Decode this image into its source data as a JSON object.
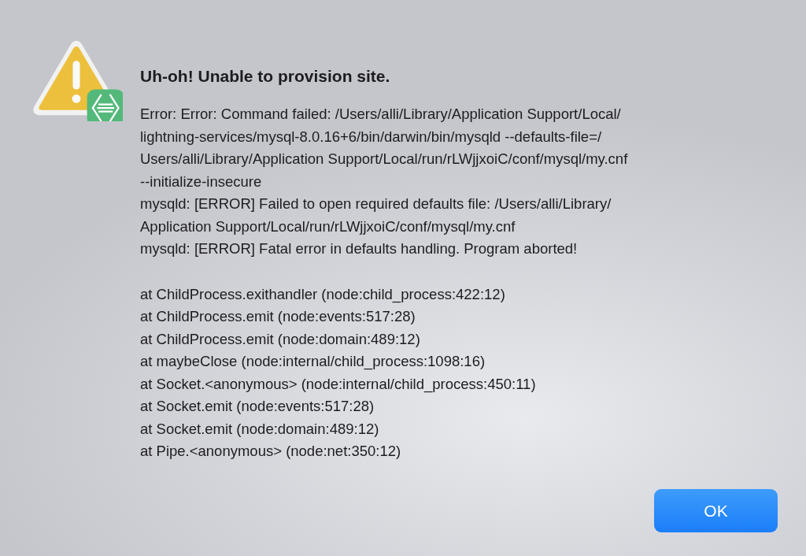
{
  "dialog": {
    "title": "Uh-oh! Unable to provision site.",
    "message_lines": [
      "Error: Error: Command failed: /Users/alli/Library/Application Support/Local/",
      "lightning-services/mysql-8.0.16+6/bin/darwin/bin/mysqld --defaults-file=/",
      "Users/alli/Library/Application Support/Local/run/rLWjjxoiC/conf/mysql/my.cnf",
      "--initialize-insecure",
      "mysqld: [ERROR] Failed to open required defaults file: /Users/alli/Library/",
      "Application Support/Local/run/rLWjjxoiC/conf/mysql/my.cnf",
      "mysqld: [ERROR] Fatal error in defaults handling. Program aborted!"
    ],
    "stack_lines": [
      "at ChildProcess.exithandler (node:child_process:422:12)",
      "at ChildProcess.emit (node:events:517:28)",
      "at ChildProcess.emit (node:domain:489:12)",
      "at maybeClose (node:internal/child_process:1098:16)",
      "at Socket.<anonymous> (node:internal/child_process:450:11)",
      "at Socket.emit (node:events:517:28)",
      "at Socket.emit (node:domain:489:12)",
      "at Pipe.<anonymous> (node:net:350:12)"
    ],
    "buttons": [
      {
        "label": "OK",
        "default": true
      }
    ]
  }
}
